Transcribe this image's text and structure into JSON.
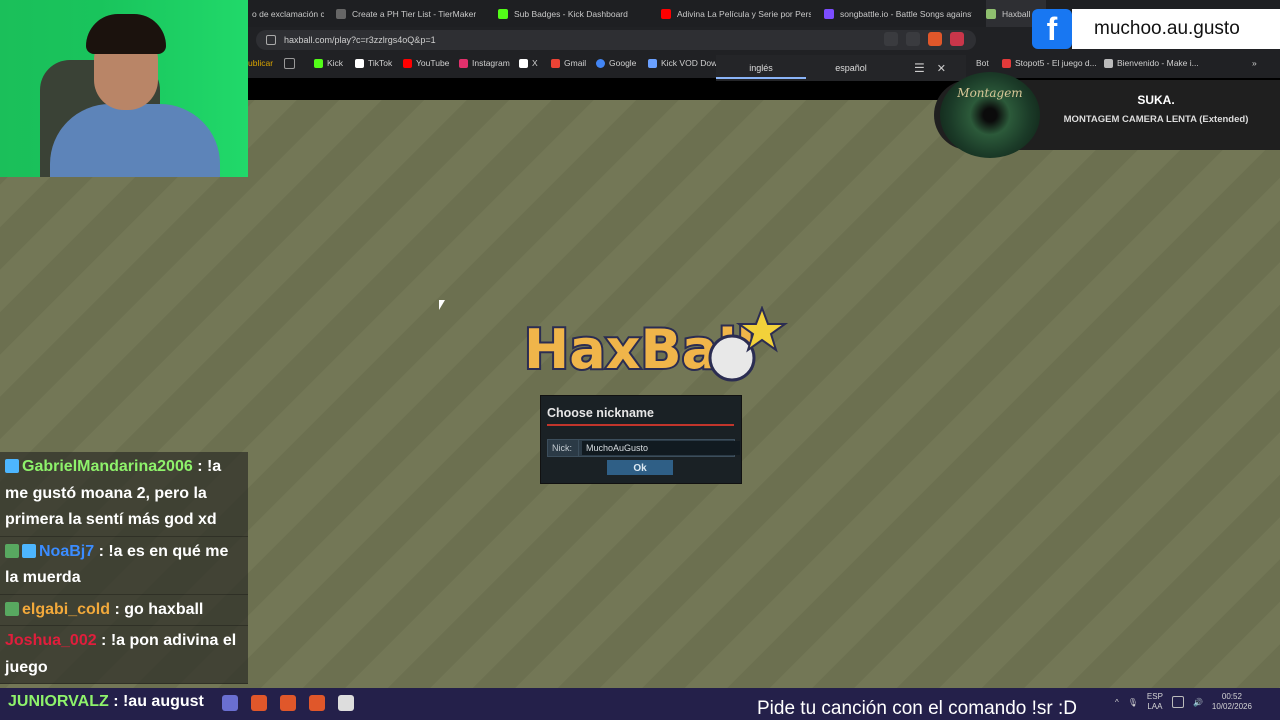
{
  "browser": {
    "tabs": [
      {
        "label": "o de exclamación c",
        "color": "#c23b3b"
      },
      {
        "label": "Create a PH Tier List - TierMaker",
        "color": "#666666"
      },
      {
        "label": "Sub Badges - Kick Dashboard",
        "color": "#53fc18"
      },
      {
        "label": "Adivina La Película y Serie por Perso",
        "color": "#ff0000"
      },
      {
        "label": "songbattle.io - Battle Songs against",
        "color": "#7c4dff"
      },
      {
        "label": "Haxball P",
        "color": "#8fbf6f"
      }
    ],
    "url": "haxball.com/play?c=r3zzlrgs4oQ&p=1",
    "bookmarks": [
      {
        "label": "ublicar",
        "color": "#d9a400"
      },
      {
        "label": "",
        "color": "#888888"
      },
      {
        "label": "Kick",
        "color": "#53fc18"
      },
      {
        "label": "TikTok",
        "color": "#ffffff"
      },
      {
        "label": "YouTube",
        "color": "#ff0000"
      },
      {
        "label": "Instagram",
        "color": "#e1306c"
      },
      {
        "label": "X",
        "color": "#ffffff"
      },
      {
        "label": "Gmail",
        "color": "#ea4335"
      },
      {
        "label": "Google",
        "color": "#4285f4"
      },
      {
        "label": "Kick VOD Dow",
        "color": "#6aa0ff"
      },
      {
        "label": "Bot",
        "color": "#cccccc"
      },
      {
        "label": "Stopot5 - El juego d...",
        "color": "#e23a3a"
      },
      {
        "label": "Bienvenido - Make i...",
        "color": "#cccccc"
      }
    ],
    "translate": {
      "source": "inglés",
      "target": "español"
    }
  },
  "overlay": {
    "facebook_handle": "muchoo.au.gusto",
    "facebook_letter": "f",
    "now_playing": {
      "artist": "SUKA.",
      "song": "MONTAGEM CAMERA LENTA (Extended)",
      "cover_text": "Montagem"
    }
  },
  "game": {
    "logo_text": "HaxBall",
    "dialog": {
      "title": "Choose nickname",
      "nick_label": "Nick:",
      "nick_value": "MuchoAuGusto",
      "ok_label": "Ok"
    }
  },
  "chat": [
    {
      "user": "GabrielMandarina2006",
      "user_color": "#8ef26b",
      "text": " : !a me gustó moana 2, pero la primera la sentí más god xd",
      "badges": [
        "#4db6ff"
      ]
    },
    {
      "user": "NoaBj7",
      "user_color": "#3b8cff",
      "text": " : !a es en qué me la muerda",
      "badges": [
        "#58a860",
        "#4db6ff"
      ]
    },
    {
      "user": "elgabi_cold",
      "user_color": "#f2a93b",
      "text": " : go haxball",
      "badges": [
        "#58a860"
      ]
    },
    {
      "user": "Joshua_002",
      "user_color": "#e01e3c",
      "text": " : !a pon adivina el juego",
      "badges": []
    }
  ],
  "taskbar": {
    "last_user": "JUNIORVALZ",
    "last_text": " : !au august",
    "ticker": "Pide tu canción con el comando !sr :D",
    "lang": "ESP",
    "region": "LAA",
    "time": "00:52",
    "date": "10/02/2026"
  }
}
